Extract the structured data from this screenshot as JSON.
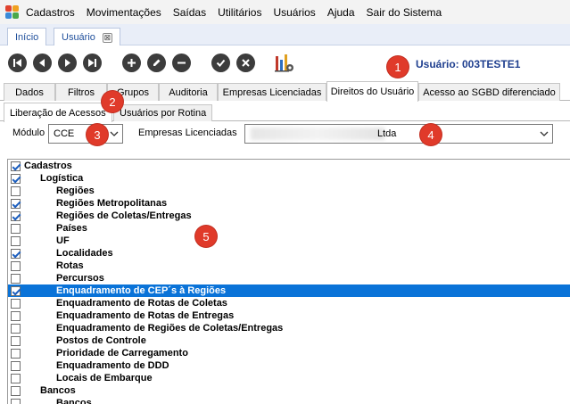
{
  "menu": [
    "Cadastros",
    "Movimentações",
    "Saídas",
    "Utilitários",
    "Usuários",
    "Ajuda",
    "Sair do Sistema"
  ],
  "doc_tabs": {
    "inicio": "Início",
    "usuario": "Usuário",
    "close": "⊠"
  },
  "user_info": "Usuário: 003TESTE1",
  "markers": [
    "1",
    "2",
    "3",
    "4",
    "5"
  ],
  "main_tabs": [
    "Dados",
    "Filtros",
    "Grupos",
    "Auditoria",
    "Empresas Licenciadas",
    "Direitos do Usuário",
    "Acesso ao SGBD diferenciado"
  ],
  "sub_tabs": [
    "Liberação de Acessos",
    "Usuários por Rotina"
  ],
  "filters": {
    "modulo_label": "Módulo",
    "modulo_value": "CCE",
    "empresas_label": "Empresas Licenciadas",
    "empresas_value": "Ltda"
  },
  "tree": [
    {
      "label": "Cadastros",
      "checked": true,
      "level": 0
    },
    {
      "label": "Logística",
      "checked": true,
      "level": 1
    },
    {
      "label": "Regiões",
      "checked": false,
      "level": 2
    },
    {
      "label": "Regiões Metropolitanas",
      "checked": true,
      "level": 2
    },
    {
      "label": "Regiões de Coletas/Entregas",
      "checked": true,
      "level": 2
    },
    {
      "label": "Países",
      "checked": false,
      "level": 2
    },
    {
      "label": "UF",
      "checked": false,
      "level": 2
    },
    {
      "label": "Localidades",
      "checked": true,
      "level": 2
    },
    {
      "label": "Rotas",
      "checked": false,
      "level": 2
    },
    {
      "label": "Percursos",
      "checked": false,
      "level": 2
    },
    {
      "label": "Enquadramento de CEP´s à Regiões",
      "checked": true,
      "level": 2,
      "selected": true
    },
    {
      "label": "Enquadramento de Rotas de Coletas",
      "checked": false,
      "level": 2
    },
    {
      "label": "Enquadramento de Rotas de Entregas",
      "checked": false,
      "level": 2
    },
    {
      "label": "Enquadramento de Regiões de Coletas/Entregas",
      "checked": false,
      "level": 2
    },
    {
      "label": "Postos de Controle",
      "checked": false,
      "level": 2
    },
    {
      "label": "Prioridade de Carregamento",
      "checked": false,
      "level": 2
    },
    {
      "label": "Enquadramento de DDD",
      "checked": false,
      "level": 2
    },
    {
      "label": "Locais de Embarque",
      "checked": false,
      "level": 2
    },
    {
      "label": "Bancos",
      "checked": false,
      "level": 1
    },
    {
      "label": "Bancos",
      "checked": false,
      "level": 2
    }
  ],
  "colors": {
    "selection": "#0a73d8",
    "marker": "#e03a2a",
    "user_text": "#1f3f8f"
  }
}
